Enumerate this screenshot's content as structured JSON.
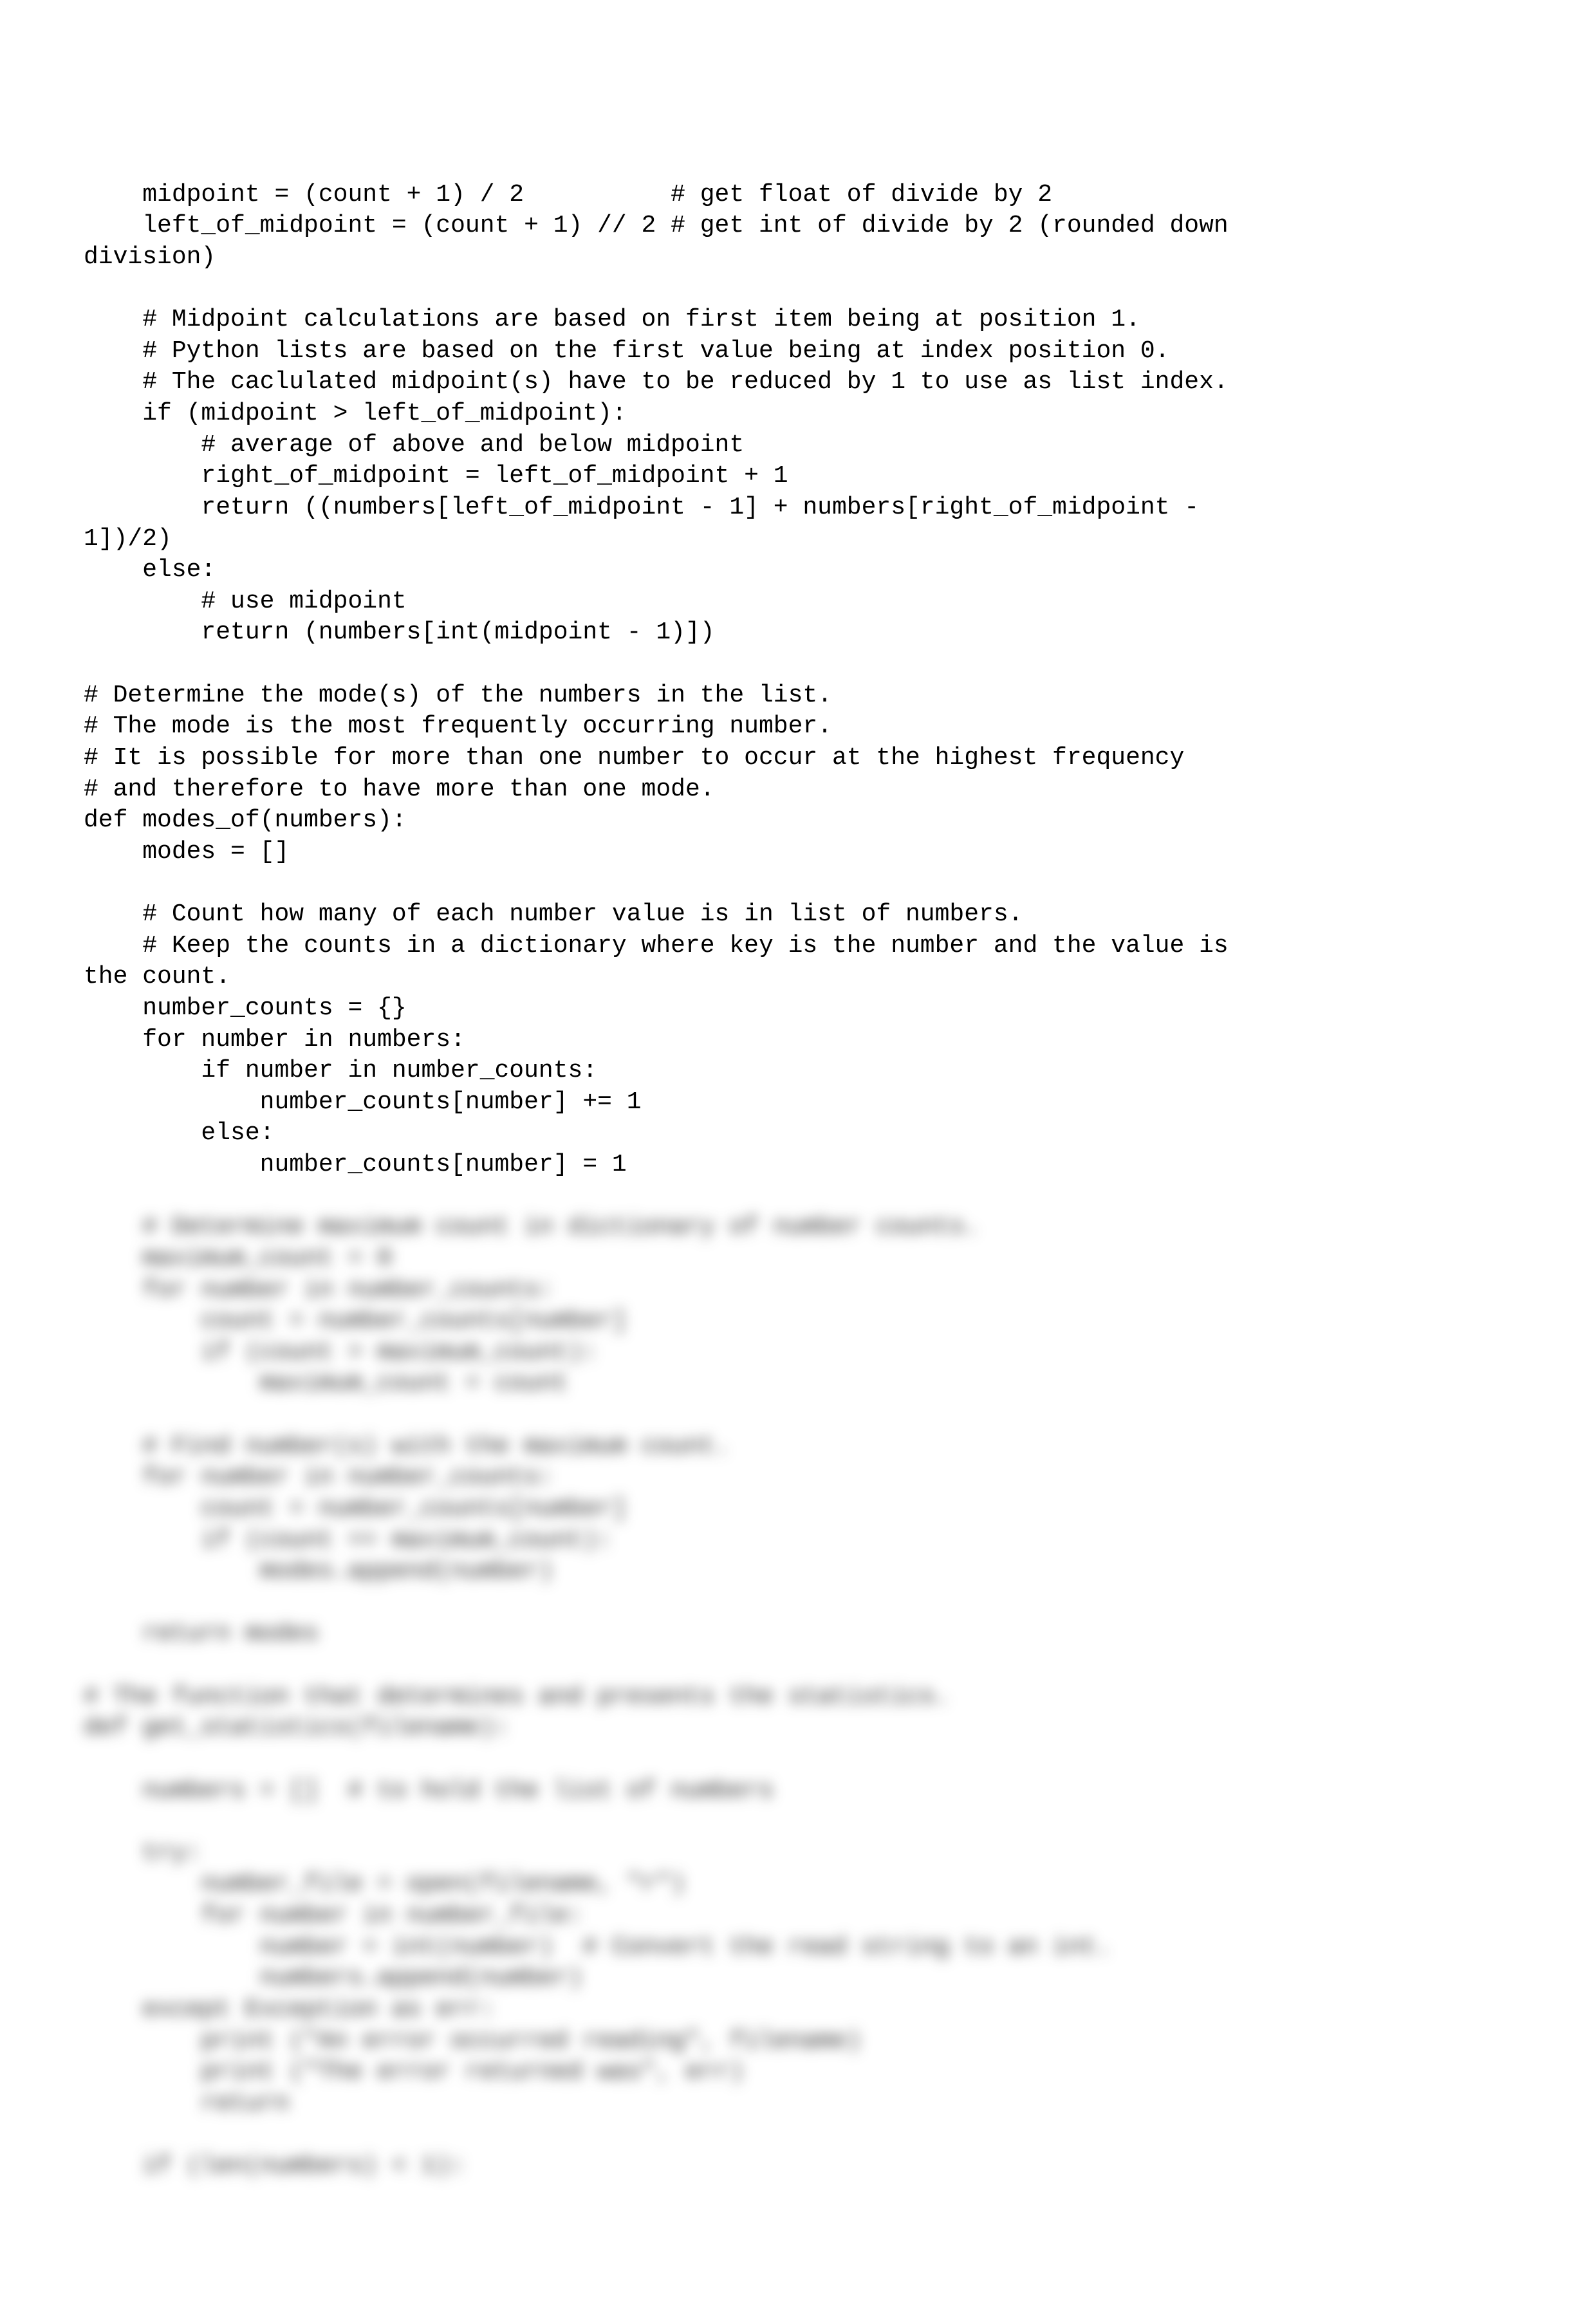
{
  "code": {
    "visible": "    midpoint = (count + 1) / 2          # get float of divide by 2\n    left_of_midpoint = (count + 1) // 2 # get int of divide by 2 (rounded down\ndivision)\n\n    # Midpoint calculations are based on first item being at position 1.\n    # Python lists are based on the first value being at index position 0.\n    # The caclulated midpoint(s) have to be reduced by 1 to use as list index.\n    if (midpoint > left_of_midpoint):\n        # average of above and below midpoint\n        right_of_midpoint = left_of_midpoint + 1\n        return ((numbers[left_of_midpoint - 1] + numbers[right_of_midpoint -\n1])/2)\n    else:\n        # use midpoint\n        return (numbers[int(midpoint - 1)])\n\n# Determine the mode(s) of the numbers in the list.\n# The mode is the most frequently occurring number.\n# It is possible for more than one number to occur at the highest frequency\n# and therefore to have more than one mode.\ndef modes_of(numbers):\n    modes = []\n\n    # Count how many of each number value is in list of numbers.\n    # Keep the counts in a dictionary where key is the number and the value is\nthe count.\n    number_counts = {}\n    for number in numbers:\n        if number in number_counts:\n            number_counts[number] += 1\n        else:\n            number_counts[number] = 1\n",
    "blurred": "    # Determine maximum count in dictionary of number counts.\n    maximum_count = 0\n    for number in number_counts:\n        count = number_counts[number]\n        if (count > maximum_count):\n            maximum_count = count\n\n    # Find number(s) with the maximum count.\n    for number in number_counts:\n        count = number_counts[number]\n        if (count == maximum_count):\n            modes.append(number)\n\n    return modes\n\n# The function that determines and presents the statistics.\ndef get_statistics(filename):\n\n    numbers = []  # to hold the list of numbers\n\n    try:\n        number_file = open(filename, \"r\")\n        for number in number_file:\n            number = int(number)  # Convert the read string to an int.\n            numbers.append(number)\n    except Exception as err:\n        print (\"An error occurred reading\", filename)\n        print (\"The error returned was\", err)\n        return\n\n    if (len(numbers) < 1):"
  }
}
